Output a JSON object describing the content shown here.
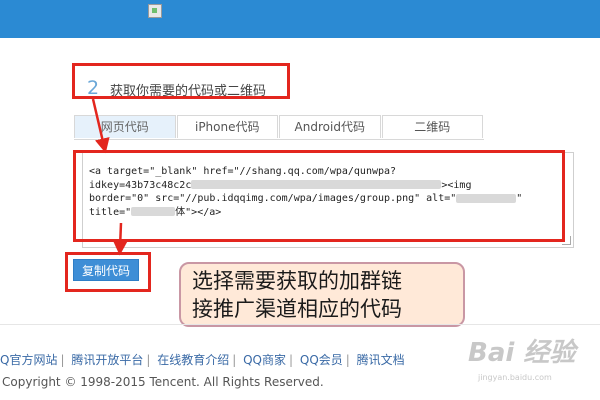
{
  "step": {
    "number": "2",
    "title": "获取你需要的代码或二维码"
  },
  "tabs": [
    {
      "label": "网页代码",
      "active": true
    },
    {
      "label": "iPhone代码",
      "active": false
    },
    {
      "label": "Android代码",
      "active": false
    },
    {
      "label": "二维码",
      "active": false
    }
  ],
  "code": {
    "line1": "<a target=\"_blank\" href=\"//shang.qq.com/wpa/qunwpa?",
    "line2a": "idkey=43b73c48c2c",
    "line2b": "><img",
    "line3a": "border=\"0\" src=\"//pub.idqqimg.com/wpa/images/group.png\" alt=\"",
    "line3b": "\"",
    "line4a": "title=\"",
    "line4b": "体\"></a>"
  },
  "copy_button": {
    "label": "复制代码"
  },
  "callout": {
    "line1": "选择需要获取的加群链",
    "line2": "接推广渠道相应的代码"
  },
  "footer": {
    "links": [
      "Q官方网站",
      "腾讯开放平台",
      "在线教育介绍",
      "QQ商家",
      "QQ会员",
      "腾讯文档"
    ],
    "copyright": "Copyright © 1998-2015 Tencent. All Rights Reserved."
  },
  "watermark": {
    "main": "Bai 经验",
    "sub": "jingyan.baidu.com"
  },
  "colors": {
    "top_bar": "#2b8ad3",
    "highlight_red": "#e3261e",
    "button_blue": "#3e8ed6",
    "callout_bg": "#ffe9d8"
  }
}
